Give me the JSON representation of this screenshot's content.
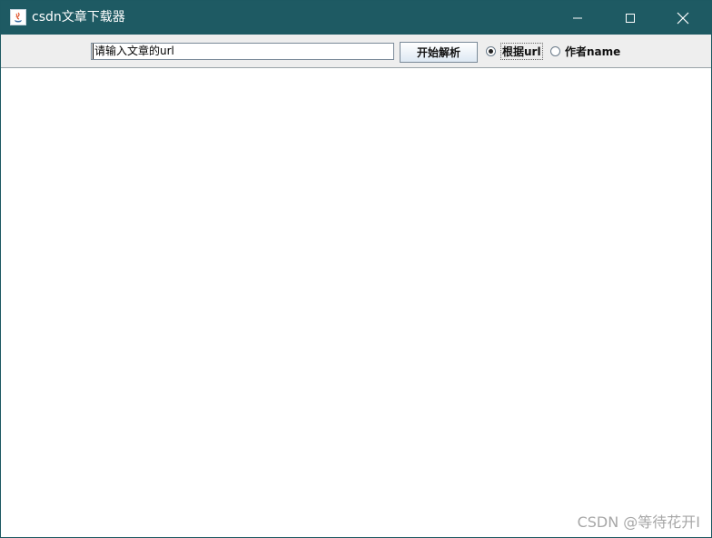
{
  "window": {
    "title": "csdn文章下载器"
  },
  "toolbar": {
    "url_input_value": "请输入文章的url",
    "parse_button_label": "开始解析",
    "radio_by_url_label": "根据url",
    "radio_by_author_label": "作者name",
    "radio_selected": "by_url"
  },
  "watermark": {
    "text": "CSDN @等待花开I"
  },
  "colors": {
    "titlebar": "#1e5a63",
    "toolbar": "#eeeeee",
    "content": "#ffffff"
  }
}
